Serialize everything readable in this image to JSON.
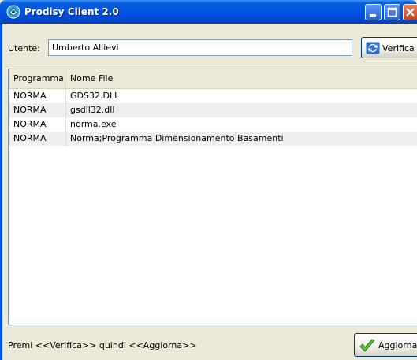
{
  "window": {
    "title": "Prodisy Client 2.0",
    "app_icon": "prodisy-app-icon",
    "controls": {
      "minimize_icon": "minimize-icon",
      "maximize_icon": "maximize-icon",
      "close_icon": "close-icon"
    }
  },
  "user": {
    "label": "Utente:",
    "value": "Umberto Allievi"
  },
  "verify_button": {
    "label": "Verifica",
    "icon": "refresh-icon"
  },
  "file_list": {
    "columns": [
      "Programma",
      "Nome File"
    ],
    "rows": [
      [
        "NORMA",
        "GDS32.DLL"
      ],
      [
        "NORMA",
        "gsdll32.dll"
      ],
      [
        "NORMA",
        "norma.exe"
      ],
      [
        "NORMA",
        "Norma;Programma Dimensionamento Basamenti"
      ]
    ]
  },
  "status": {
    "text": "Premi <<Verifica>> quindi <<Aggiorna>>"
  },
  "update_button": {
    "label": "Aggiorna",
    "icon": "checkmark-icon"
  },
  "colors": {
    "titlebar": "#0054e3",
    "window_bg": "#ece9d8",
    "close_button": "#c73d1a",
    "row_alt": "#eeeeee"
  }
}
